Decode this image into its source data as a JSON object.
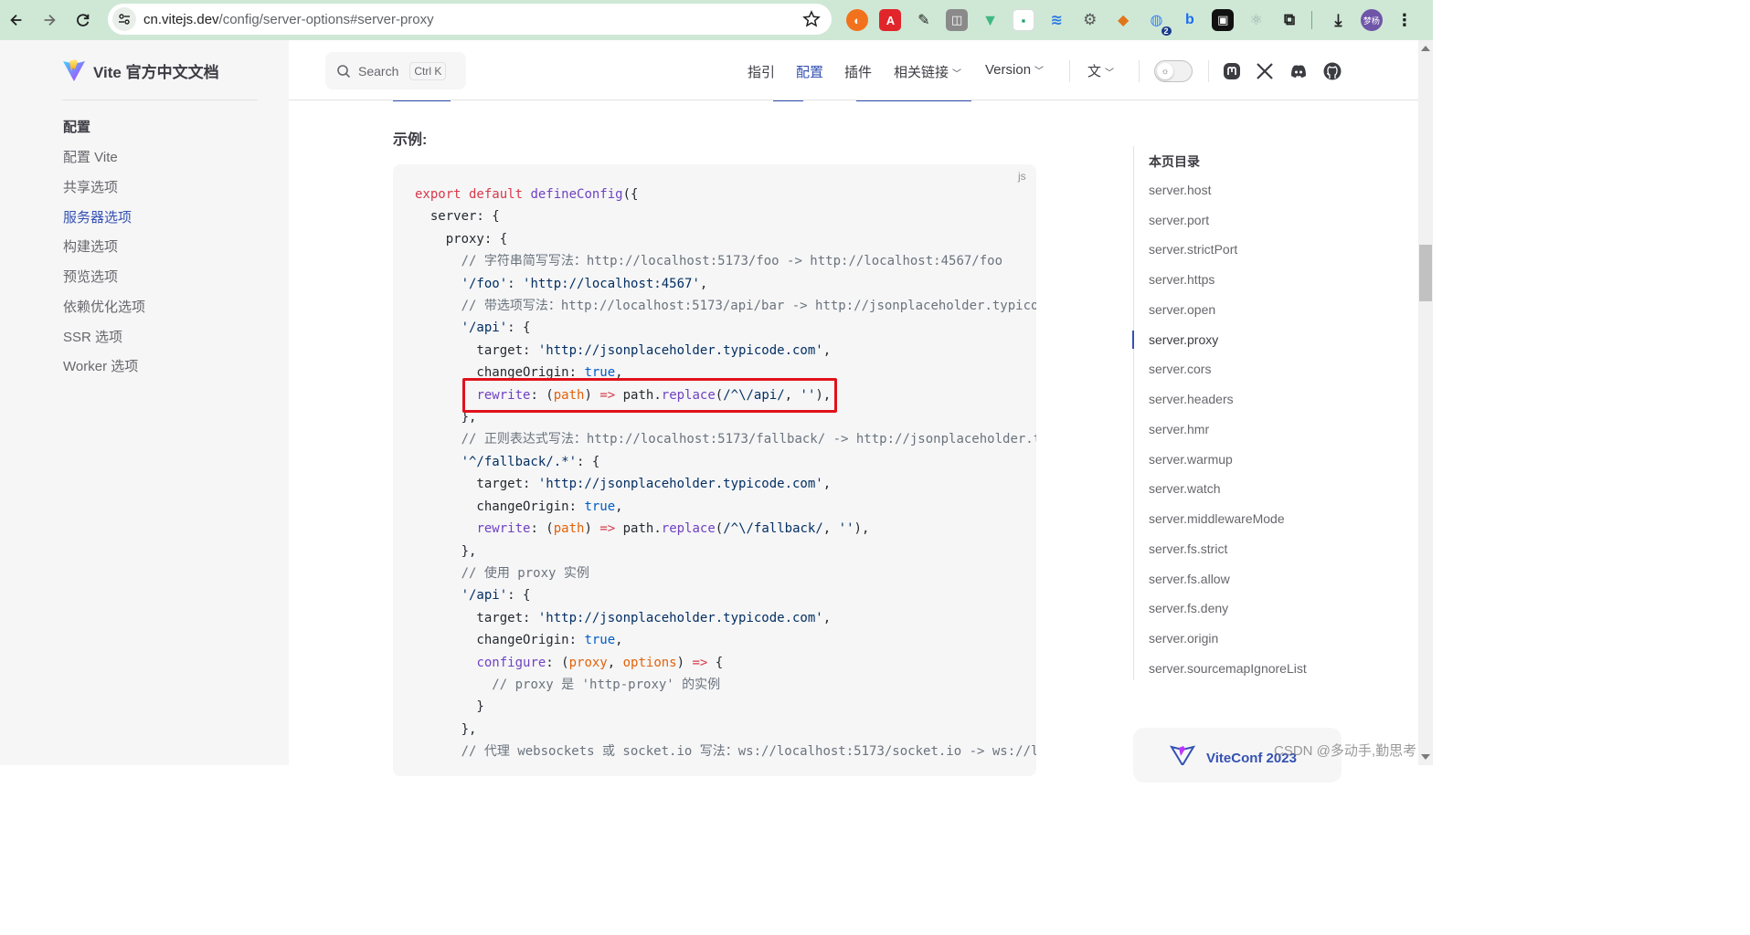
{
  "browser": {
    "url_host": "cn.vitejs.dev",
    "url_path": "/config/server-options#server-proxy",
    "extension_badge": "2",
    "profile_label": "梦杨"
  },
  "site": {
    "title": "Vite 官方中文文档",
    "search": {
      "label": "Search",
      "shortcut": "Ctrl K"
    },
    "nav": [
      {
        "label": "指引"
      },
      {
        "label": "配置"
      },
      {
        "label": "插件"
      },
      {
        "label": "相关链接"
      },
      {
        "label": "Version"
      }
    ],
    "accent_color": "#3451b2"
  },
  "sidebar": {
    "group": "配置",
    "items": [
      {
        "label": "配置 Vite"
      },
      {
        "label": "共享选项"
      },
      {
        "label": "服务器选项"
      },
      {
        "label": "构建选项"
      },
      {
        "label": "预览选项"
      },
      {
        "label": "依赖优化选项"
      },
      {
        "label": "SSR 选项"
      },
      {
        "label": "Worker 选项"
      }
    ],
    "active_index": 2
  },
  "content": {
    "example_heading": "示例:",
    "code_lang": "js"
  },
  "outline": {
    "title": "本页目录",
    "items": [
      {
        "label": "server.host"
      },
      {
        "label": "server.port"
      },
      {
        "label": "server.strictPort"
      },
      {
        "label": "server.https"
      },
      {
        "label": "server.open"
      },
      {
        "label": "server.proxy"
      },
      {
        "label": "server.cors"
      },
      {
        "label": "server.headers"
      },
      {
        "label": "server.hmr"
      },
      {
        "label": "server.warmup"
      },
      {
        "label": "server.watch"
      },
      {
        "label": "server.middlewareMode"
      },
      {
        "label": "server.fs.strict"
      },
      {
        "label": "server.fs.allow"
      },
      {
        "label": "server.fs.deny"
      },
      {
        "label": "server.origin"
      },
      {
        "label": "server.sourcemapIgnoreList"
      }
    ],
    "active_index": 5
  },
  "promo": {
    "label": "ViteConf 2023"
  },
  "watermark": "CSDN @多动手,勤思考"
}
